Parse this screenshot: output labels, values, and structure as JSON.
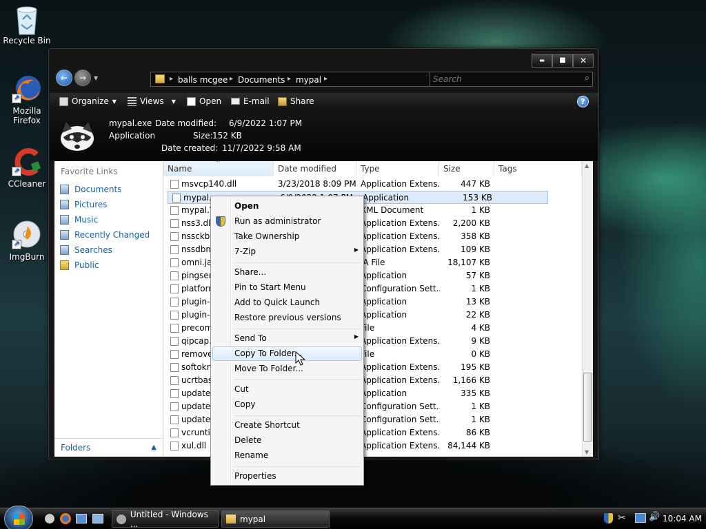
{
  "desktop": {
    "icons": [
      {
        "label": "Recycle Bin",
        "icon": "recycle-bin-icon"
      },
      {
        "label": "Mozilla Firefox",
        "icon": "firefox-icon"
      },
      {
        "label": "CCleaner",
        "icon": "ccleaner-icon"
      },
      {
        "label": "ImgBurn",
        "icon": "imgburn-icon"
      }
    ]
  },
  "window": {
    "buttons": {
      "minimize": "▬",
      "maximize": "■",
      "close": "✕"
    },
    "address": {
      "parts": [
        "balls mcgee",
        "Documents",
        "mypal"
      ],
      "separator": "▸"
    },
    "search": {
      "placeholder": "Search"
    },
    "toolbar": {
      "organize": "Organize",
      "views": "Views",
      "open": "Open",
      "email": "E-mail",
      "share": "Share",
      "help": "?"
    },
    "details": {
      "filename": "mypal.exe",
      "type": "Application",
      "modified_label": "Date modified:",
      "modified_value": "6/9/2022 1:07 PM",
      "size_label": "Size:",
      "size_value": "152 KB",
      "created_label": "Date created:",
      "created_value": "11/7/2022 9:58 AM"
    },
    "nav": {
      "header": "Favorite Links",
      "items": [
        "Documents",
        "Pictures",
        "Music",
        "Recently Changed",
        "Searches",
        "Public"
      ],
      "folders": "Folders"
    },
    "list": {
      "columns": [
        "Name",
        "Date modified",
        "Type",
        "Size",
        "Tags"
      ],
      "rows": [
        {
          "name": "msvcp140.dll",
          "date": "3/23/2018 8:09 PM",
          "type": "Application Extens...",
          "size": "447 KB"
        },
        {
          "name": "mypal.exe",
          "date": "6/9/2022 1:07 PM",
          "type": "Application",
          "size": "153 KB"
        },
        {
          "name": "mypal.V",
          "date": "",
          "type": "XML Document",
          "size": "1 KB"
        },
        {
          "name": "nss3.dll",
          "date": "",
          "type": "Application Extens...",
          "size": "2,200 KB"
        },
        {
          "name": "nssckbi.",
          "date": "",
          "type": "Application Extens...",
          "size": "358 KB"
        },
        {
          "name": "nssdbm",
          "date": "",
          "type": "Application Extens...",
          "size": "109 KB"
        },
        {
          "name": "omni.ja",
          "date": "",
          "type": "JA File",
          "size": "18,107 KB"
        },
        {
          "name": "pingsen",
          "date": "",
          "type": "Application",
          "size": "57 KB"
        },
        {
          "name": "platforn",
          "date": "",
          "type": "Configuration Sett...",
          "size": "1 KB"
        },
        {
          "name": "plugin-c",
          "date": "",
          "type": "Application",
          "size": "13 KB"
        },
        {
          "name": "plugin-l",
          "date": "",
          "type": "Application",
          "size": "22 KB"
        },
        {
          "name": "precom",
          "date": "",
          "type": "File",
          "size": "4 KB"
        },
        {
          "name": "qipcap.",
          "date": "",
          "type": "Application Extens...",
          "size": "9 KB"
        },
        {
          "name": "remove",
          "date": "",
          "type": "File",
          "size": "0 KB"
        },
        {
          "name": "softokn3",
          "date": "",
          "type": "Application Extens...",
          "size": "195 KB"
        },
        {
          "name": "ucrtbase",
          "date": "",
          "type": "Application Extens...",
          "size": "1,166 KB"
        },
        {
          "name": "updater",
          "date": "",
          "type": "Application",
          "size": "335 KB"
        },
        {
          "name": "updater",
          "date": "",
          "type": "Configuration Sett...",
          "size": "1 KB"
        },
        {
          "name": "update-",
          "date": "",
          "type": "Configuration Sett...",
          "size": "1 KB"
        },
        {
          "name": "vcruntin",
          "date": "",
          "type": "Application Extens...",
          "size": "86 KB"
        },
        {
          "name": "xul.dll",
          "date": "",
          "type": "Application Extens...",
          "size": "84,144 KB"
        }
      ]
    }
  },
  "context_menu": {
    "items": [
      "Open",
      "Run as administrator",
      "Take Ownership",
      "7-Zip",
      "Share...",
      "Pin to Start Menu",
      "Add to Quick Launch",
      "Restore previous versions",
      "Send To",
      "Copy To Folder...",
      "Move To Folder...",
      "Cut",
      "Copy",
      "Create Shortcut",
      "Delete",
      "Rename",
      "Properties"
    ],
    "highlighted": "Copy To Folder..."
  },
  "taskbar": {
    "tasks": [
      "Untitled - Windows ...",
      "mypal"
    ],
    "clock": "10:04 AM"
  },
  "colors": {
    "selection": "#dcebfb",
    "menu_highlight": "#e8f1fb",
    "link": "#1a5ea8"
  }
}
